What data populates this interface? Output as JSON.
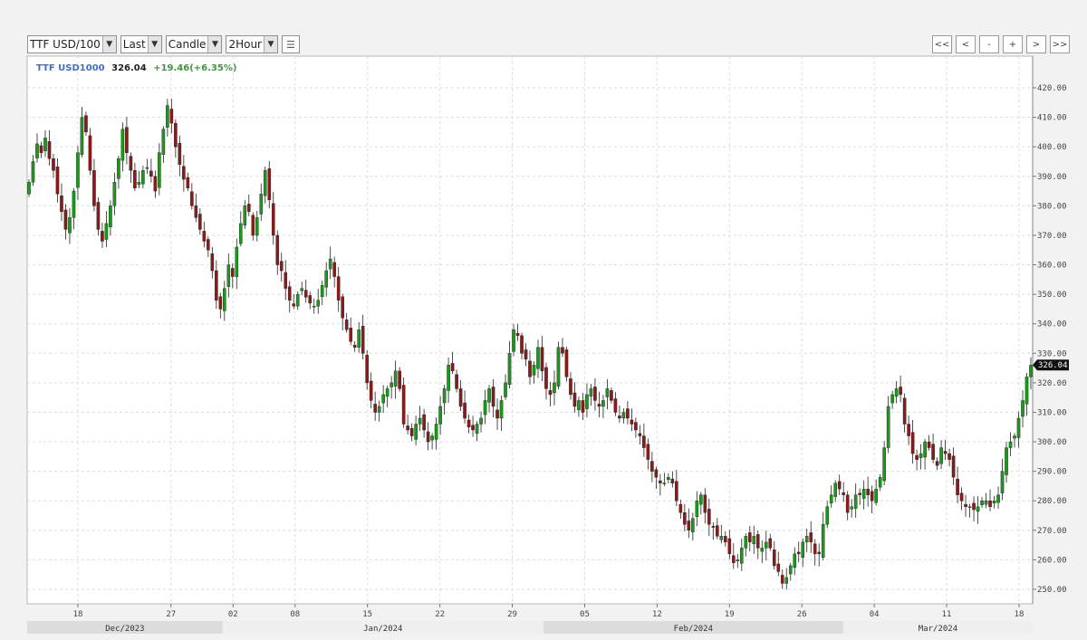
{
  "toolbar": {
    "symbol": "TTF USD/100",
    "price_type": "Last",
    "chart_type": "Candle",
    "interval": "2Hour",
    "nav_buttons": [
      "<<",
      "<",
      "-",
      "+",
      ">",
      ">>"
    ]
  },
  "header": {
    "symbol": "TTF USD1000",
    "last": "326.04",
    "change": "+19.46(+6.35%)"
  },
  "colors": {
    "up": "#1a9a1a",
    "down": "#8b1a1a",
    "change_text": "#3a9a3a",
    "symbol_text": "#3a6fd8"
  },
  "chart_data": {
    "type": "candlestick",
    "title": "",
    "xlabel": "",
    "ylabel": "",
    "ylim": [
      247,
      432
    ],
    "y_ticks": [
      "250.00",
      "260.00",
      "270.00",
      "280.00",
      "290.00",
      "300.00",
      "310.00",
      "320.00",
      "330.00",
      "340.00",
      "350.00",
      "360.00",
      "370.00",
      "380.00",
      "390.00",
      "400.00",
      "410.00",
      "420.00"
    ],
    "last_price_label": "326.04",
    "x_tick_labels": [
      "18",
      "27",
      "02",
      "08",
      "15",
      "22",
      "29",
      "05",
      "12",
      "19",
      "26",
      "04",
      "11",
      "18"
    ],
    "x_tick_dates": [
      "2023-12-18",
      "2023-12-27",
      "2024-01-02",
      "2024-01-08",
      "2024-01-15",
      "2024-01-22",
      "2024-01-29",
      "2024-02-05",
      "2024-02-12",
      "2024-02-19",
      "2024-02-26",
      "2024-03-04",
      "2024-03-11",
      "2024-03-18"
    ],
    "month_labels": [
      "Dec/2023",
      "Jan/2024",
      "Feb/2024",
      "Mar/2024"
    ],
    "grid": true,
    "closes": [
      388,
      395,
      401,
      398,
      403,
      396,
      392,
      384,
      378,
      372,
      376,
      385,
      398,
      410,
      405,
      392,
      380,
      372,
      368,
      374,
      380,
      388,
      396,
      406,
      398,
      392,
      386,
      388,
      392,
      393,
      390,
      385,
      398,
      406,
      414,
      408,
      400,
      394,
      389,
      386,
      380,
      376,
      372,
      368,
      365,
      358,
      348,
      345,
      352,
      360,
      356,
      366,
      374,
      380,
      378,
      370,
      376,
      384,
      392,
      382,
      370,
      360,
      358,
      352,
      348,
      346,
      350,
      352,
      349,
      347,
      346,
      348,
      353,
      358,
      362,
      356,
      348,
      342,
      338,
      334,
      332,
      338,
      330,
      320,
      314,
      310,
      312,
      316,
      318,
      320,
      324,
      318,
      306,
      304,
      302,
      306,
      308,
      304,
      300,
      302,
      306,
      312,
      318,
      326,
      324,
      318,
      312,
      308,
      305,
      304,
      306,
      308,
      314,
      318,
      312,
      308,
      314,
      320,
      330,
      338,
      336,
      330,
      328,
      322,
      326,
      332,
      324,
      318,
      316,
      320,
      332,
      330,
      322,
      316,
      312,
      314,
      310,
      316,
      318,
      314,
      312,
      314,
      318,
      314,
      310,
      308,
      310,
      308,
      306,
      304,
      302,
      298,
      294,
      290,
      288,
      286,
      286,
      288,
      286,
      280,
      276,
      272,
      270,
      274,
      280,
      282,
      276,
      272,
      271,
      268,
      268,
      266,
      262,
      259,
      260,
      264,
      268,
      266,
      268,
      264,
      264,
      266,
      264,
      258,
      256,
      252,
      254,
      258,
      262,
      262,
      266,
      268,
      266,
      262,
      262,
      272,
      278,
      282,
      286,
      284,
      282,
      276,
      278,
      282,
      282,
      284,
      282,
      280,
      284,
      288,
      298,
      312,
      316,
      318,
      316,
      306,
      302,
      296,
      294,
      296,
      300,
      298,
      294,
      292,
      298,
      296,
      294,
      288,
      282,
      280,
      278,
      278,
      277,
      278,
      280,
      280,
      278,
      280,
      282,
      290,
      298,
      300,
      302,
      308,
      314,
      322,
      326
    ]
  }
}
